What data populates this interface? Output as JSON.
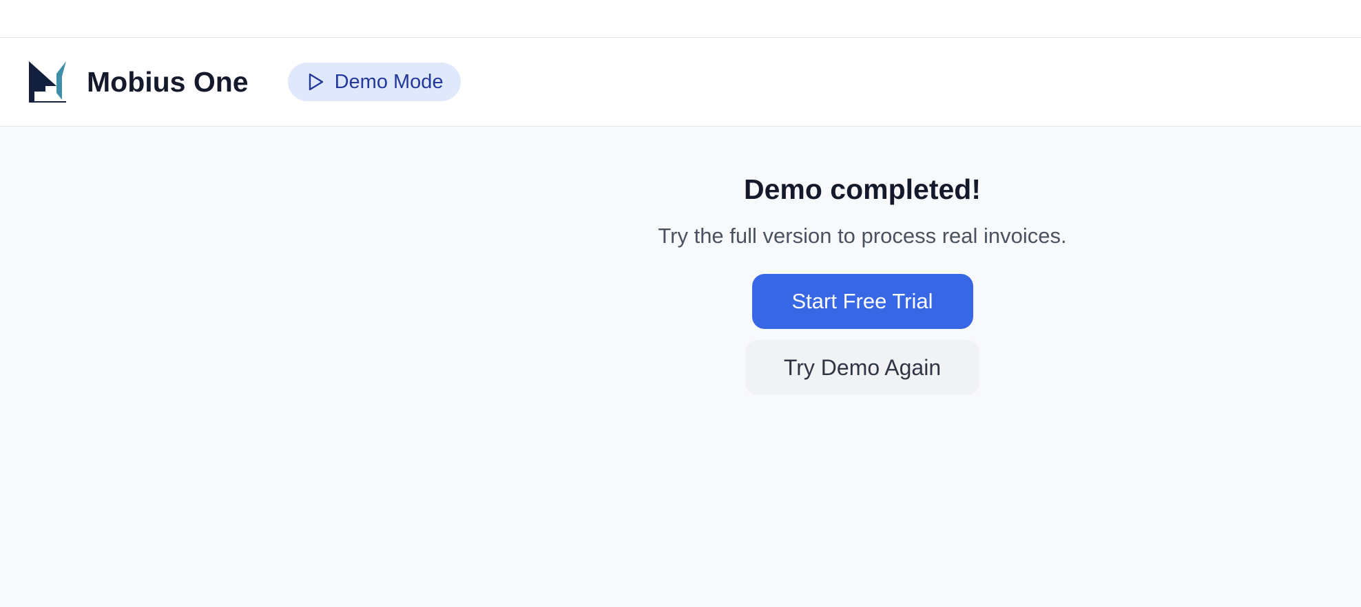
{
  "header": {
    "logo_icon": "mobius-logo-icon",
    "app_title": "Mobius One",
    "mode_badge": {
      "icon": "play-icon",
      "label": "Demo Mode"
    }
  },
  "completion": {
    "title": "Demo completed!",
    "subtitle": "Try the full version to process real invoices.",
    "primary_button": "Start Free Trial",
    "secondary_button": "Try Demo Again"
  },
  "colors": {
    "accent": "#3867e6",
    "badge_background": "#dfe9fb",
    "badge_text": "#23389b",
    "logo_dark": "#12203d",
    "logo_teal": "#3f8fa8",
    "page_background": "#f8f9fb"
  }
}
